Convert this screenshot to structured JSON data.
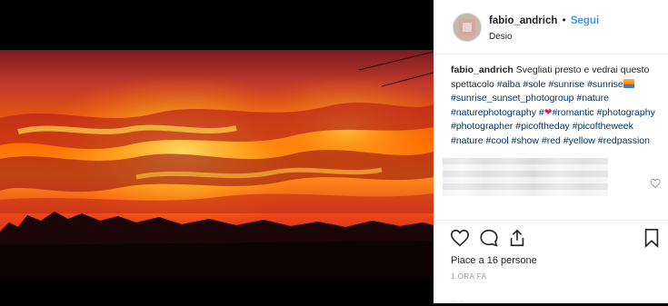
{
  "post": {
    "username": "fabio_andrich",
    "follow_label": "Segui",
    "location": "Desio",
    "caption_text": "Svegliati presto e vedrai questo spettacolo",
    "hashtags": [
      "#alba",
      "#sole",
      "#sunrise",
      "#sunrise",
      "#sunrise_sunset_photogroup",
      "#nature",
      "#naturephotography",
      "#",
      "#romantic",
      "#photography",
      "#photographer",
      "#picoftheday",
      "#picoftheweek",
      "#nature",
      "#cool",
      "#show",
      "#red",
      "#yellow",
      "#redpassion"
    ],
    "likes": "Piace a 16 persone",
    "time": "1 ORA FA"
  },
  "colors": {
    "link": "#3897f0",
    "hashtag": "#003569",
    "text": "#262626",
    "muted": "#999999"
  },
  "icons": {
    "like": "heart-outline-icon",
    "comment": "comment-bubble-icon",
    "share": "share-icon",
    "save": "bookmark-icon"
  }
}
